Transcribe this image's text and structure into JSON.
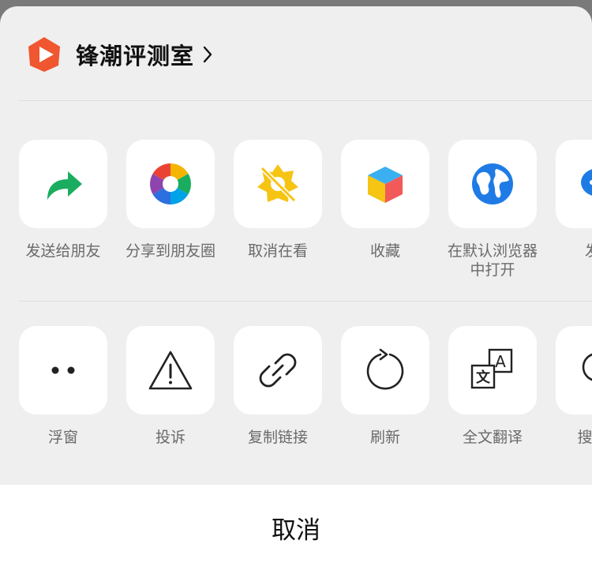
{
  "header": {
    "account_name": "锋潮评测室",
    "logo_icon": "play-logo-icon",
    "chevron_icon": "chevron-right-icon"
  },
  "share_row": [
    {
      "label": "发送给朋友",
      "icon": "forward-arrow-icon"
    },
    {
      "label": "分享到朋友圈",
      "icon": "moments-aperture-icon"
    },
    {
      "label": "取消在看",
      "icon": "unlike-wow-icon"
    },
    {
      "label": "收藏",
      "icon": "favorites-cube-icon"
    },
    {
      "label": "在默认浏览器\n中打开",
      "icon": "browser-globe-icon"
    },
    {
      "label": "发送\n企",
      "icon": "wecom-icon"
    }
  ],
  "action_row": [
    {
      "label": "浮窗",
      "icon": "floating-window-dots-icon"
    },
    {
      "label": "投诉",
      "icon": "warning-triangle-icon"
    },
    {
      "label": "复制链接",
      "icon": "link-icon"
    },
    {
      "label": "刷新",
      "icon": "refresh-icon"
    },
    {
      "label": "全文翻译",
      "icon": "translate-icon"
    },
    {
      "label": "搜索页",
      "icon": "search-icon"
    }
  ],
  "cancel_label": "取消",
  "colors": {
    "sheet_background": "#efefef",
    "tile_background": "#ffffff",
    "label_text": "#6a6a6a",
    "wechat_green": "#1aad5f",
    "logo_orange": "#f0562f",
    "browser_blue": "#1e7be6"
  }
}
